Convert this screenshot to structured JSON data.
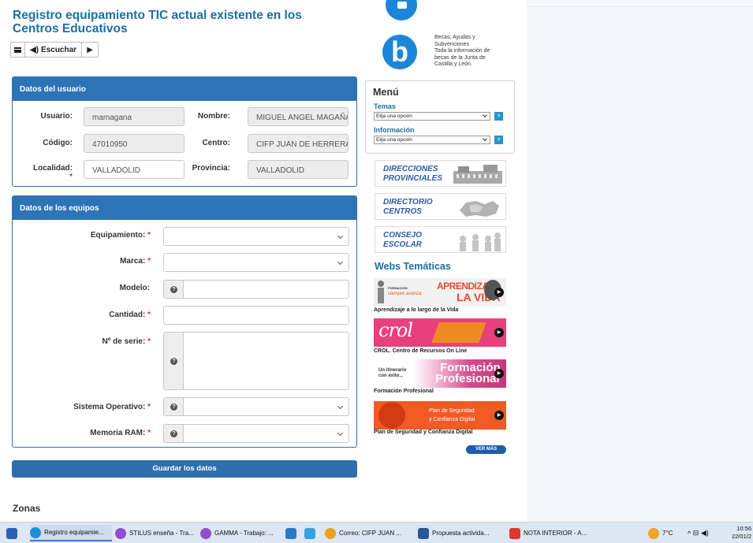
{
  "form": {
    "title": "Registro equipamiento TIC actual existente en los Centros Educativos",
    "listen_label": "Escuchar",
    "user_panel": {
      "heading": "Datos del usuario",
      "usuario_label": "Usuario:",
      "usuario_value": "mamagana",
      "nombre_label": "Nombre:",
      "nombre_value": "MIGUEL ANGEL MAGAÑA /",
      "codigo_label": "Código:",
      "codigo_value": "47010950",
      "centro_label": "Centro:",
      "centro_value": "CIFP JUAN DE HERRERA",
      "localidad_label": "Localidad:",
      "localidad_value": "VALLADOLID",
      "provincia_label": "Provincia:",
      "provincia_value": "VALLADOLID"
    },
    "equip_panel": {
      "heading": "Datos de los equipos",
      "equipamiento_label": "Equipamiento:",
      "marca_label": "Marca:",
      "modelo_label": "Modelo:",
      "cantidad_label": "Cantidad:",
      "serie_label": "Nº de serie:",
      "so_label": "Sistema Operativo:",
      "ram_label": "Memoria RAM:",
      "required_mark": "*"
    },
    "save_label": "Guardar los datos",
    "zonas_heading": "Zonas"
  },
  "sidebar": {
    "becas": {
      "title1": "Becas, Ayudas y",
      "title2": "Subvenciones",
      "desc1": "Toda la información de",
      "desc2": "becas de la Junta de",
      "desc3": "Castilla y León.",
      "logo_letter": "b"
    },
    "menu_title": "Menú",
    "temas_label": "Temas",
    "temas_value": "Elija una opción",
    "informacion_label": "Información",
    "informacion_value": "Elija una opción",
    "quick_links": [
      {
        "line1": "DIRECCIONES",
        "line2": "PROVINCIALES"
      },
      {
        "line1": "DIRECTORIO",
        "line2": "CENTROS"
      },
      {
        "line1": "CONSEJO",
        "line2": "ESCOLAR"
      }
    ],
    "webs_title": "Webs Temáticas",
    "banners": [
      {
        "caption": "Aprendizaje a lo largo de la Vida",
        "text_a": "APRENDIZAJE",
        "text_b": "LA VIDA",
        "small_a": "FORMACIÓN",
        "small_b": "siempre avanza"
      },
      {
        "caption": "CROL. Centro de Recursos On Line",
        "text_a": "crol"
      },
      {
        "caption": "Formación Profesional",
        "text_a": "Formación",
        "text_b": "Profesional",
        "small_a": "Un itinerario",
        "small_b": "con éxito..."
      },
      {
        "caption": "Plan de Seguridad y Confianza Digital",
        "text_a": "Plan de Seguridad",
        "text_b": "y Confianza Digital"
      }
    ],
    "ver_mas": "VER MÁS"
  },
  "taskbar": {
    "items": [
      "Registro equipamie...",
      "STILUS enseña - Tra...",
      "GAMMA - Trabajo: ...",
      "Correo: CIFP JUAN ...",
      "Propuesta activida...",
      "NOTA INTERIOR - A..."
    ],
    "temperature": "7°C",
    "time": "10:56",
    "date": "22/01/2"
  },
  "colors": {
    "panel_blue": "#2d74b7",
    "title_blue": "#1b6fa7",
    "required_red": "#e32d2d"
  }
}
